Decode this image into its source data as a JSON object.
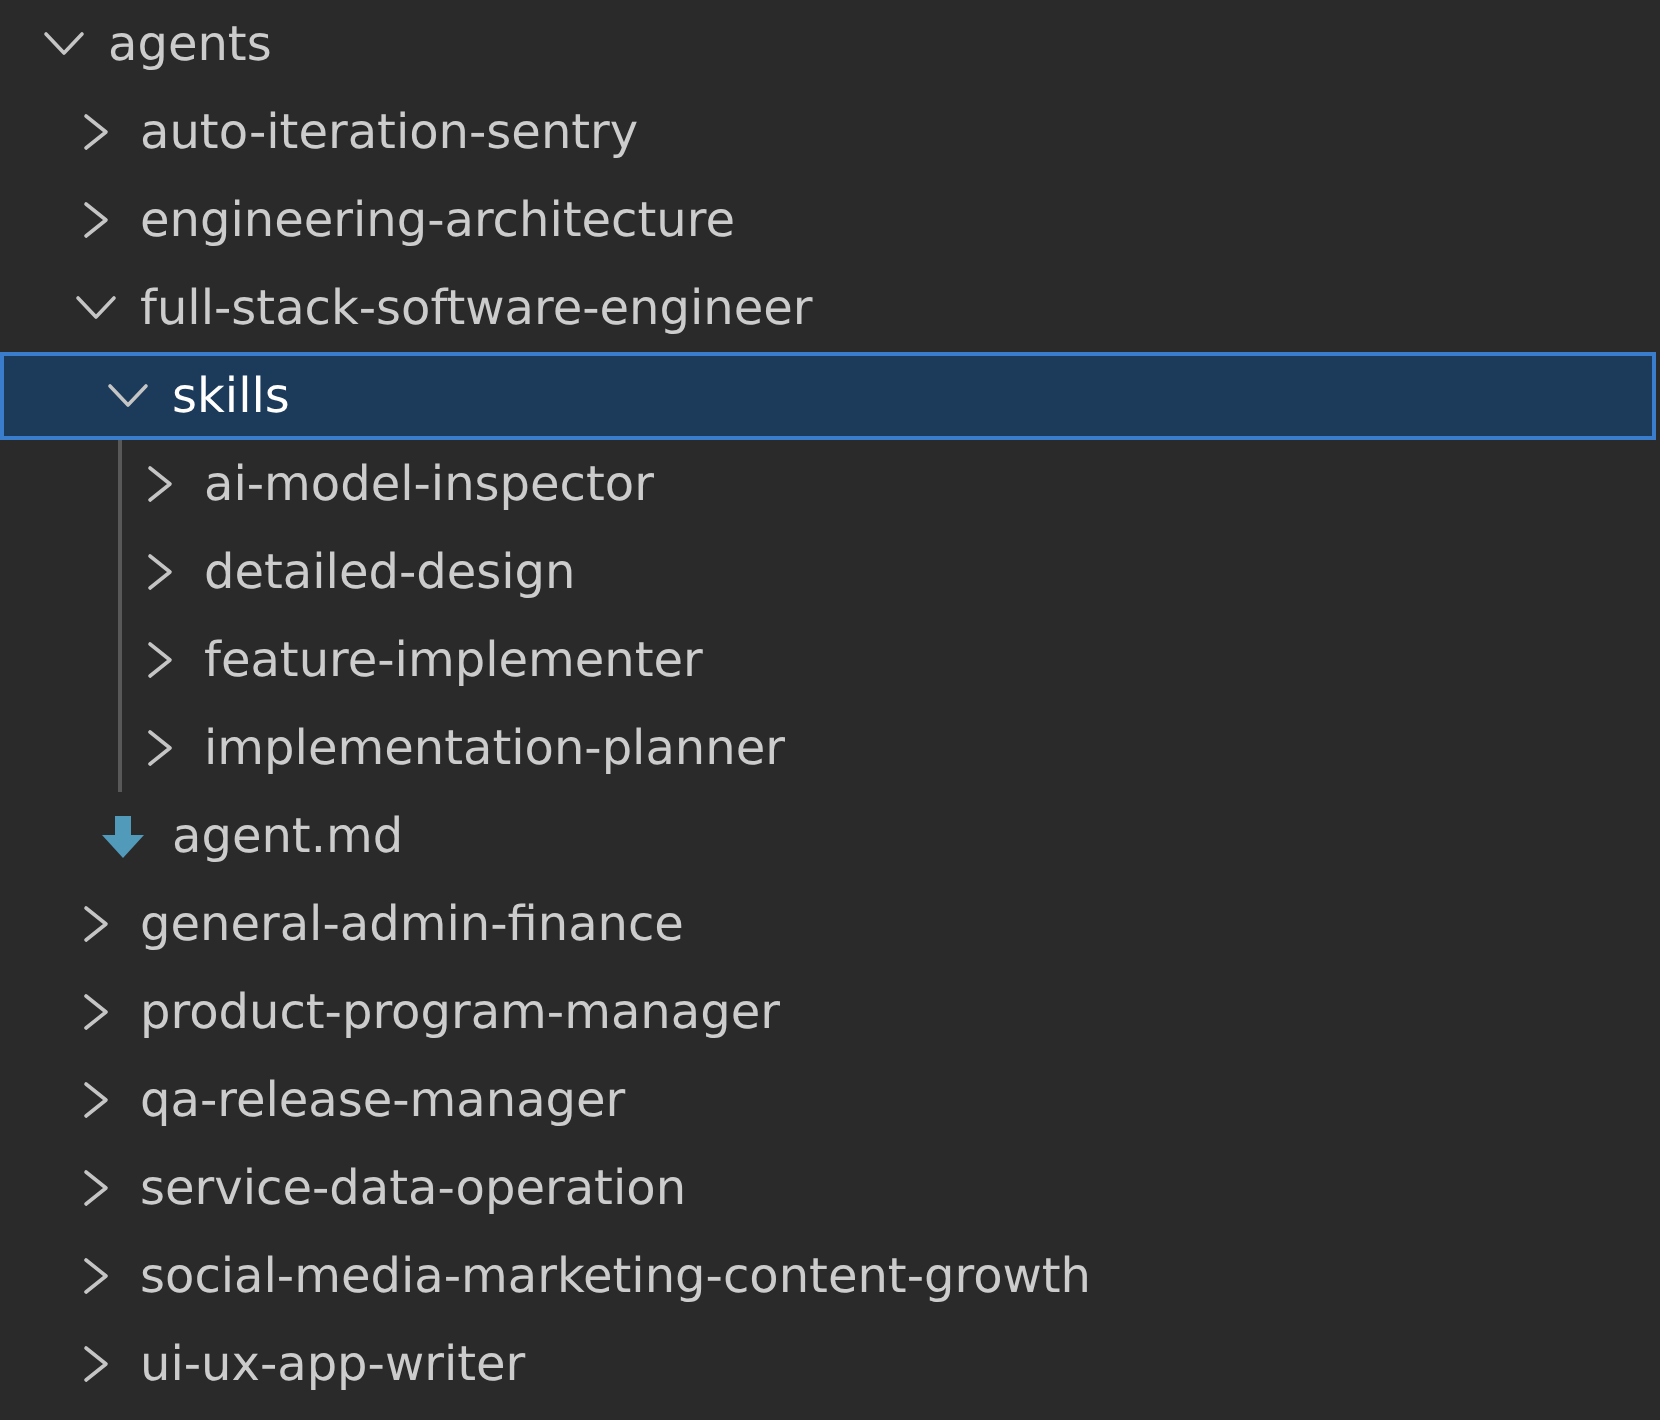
{
  "tree": [
    {
      "name": "agents",
      "kind": "folder",
      "expanded": true,
      "selected": false,
      "children": [
        {
          "name": "auto-iteration-sentry",
          "kind": "folder",
          "expanded": false,
          "selected": false
        },
        {
          "name": "engineering-architecture",
          "kind": "folder",
          "expanded": false,
          "selected": false
        },
        {
          "name": "full-stack-software-engineer",
          "kind": "folder",
          "expanded": true,
          "selected": false,
          "children": [
            {
              "name": "skills",
              "kind": "folder",
              "expanded": true,
              "selected": true,
              "children": [
                {
                  "name": "ai-model-inspector",
                  "kind": "folder",
                  "expanded": false,
                  "selected": false
                },
                {
                  "name": "detailed-design",
                  "kind": "folder",
                  "expanded": false,
                  "selected": false
                },
                {
                  "name": "feature-implementer",
                  "kind": "folder",
                  "expanded": false,
                  "selected": false
                },
                {
                  "name": "implementation-planner",
                  "kind": "folder",
                  "expanded": false,
                  "selected": false
                }
              ]
            },
            {
              "name": "agent.md",
              "kind": "file",
              "selected": false
            }
          ]
        },
        {
          "name": "general-admin-finance",
          "kind": "folder",
          "expanded": false,
          "selected": false
        },
        {
          "name": "product-program-manager",
          "kind": "folder",
          "expanded": false,
          "selected": false
        },
        {
          "name": "qa-release-manager",
          "kind": "folder",
          "expanded": false,
          "selected": false
        },
        {
          "name": "service-data-operation",
          "kind": "folder",
          "expanded": false,
          "selected": false
        },
        {
          "name": "social-media-marketing-content-growth",
          "kind": "folder",
          "expanded": false,
          "selected": false
        },
        {
          "name": "ui-ux-app-writer",
          "kind": "folder",
          "expanded": false,
          "selected": false
        }
      ]
    }
  ]
}
